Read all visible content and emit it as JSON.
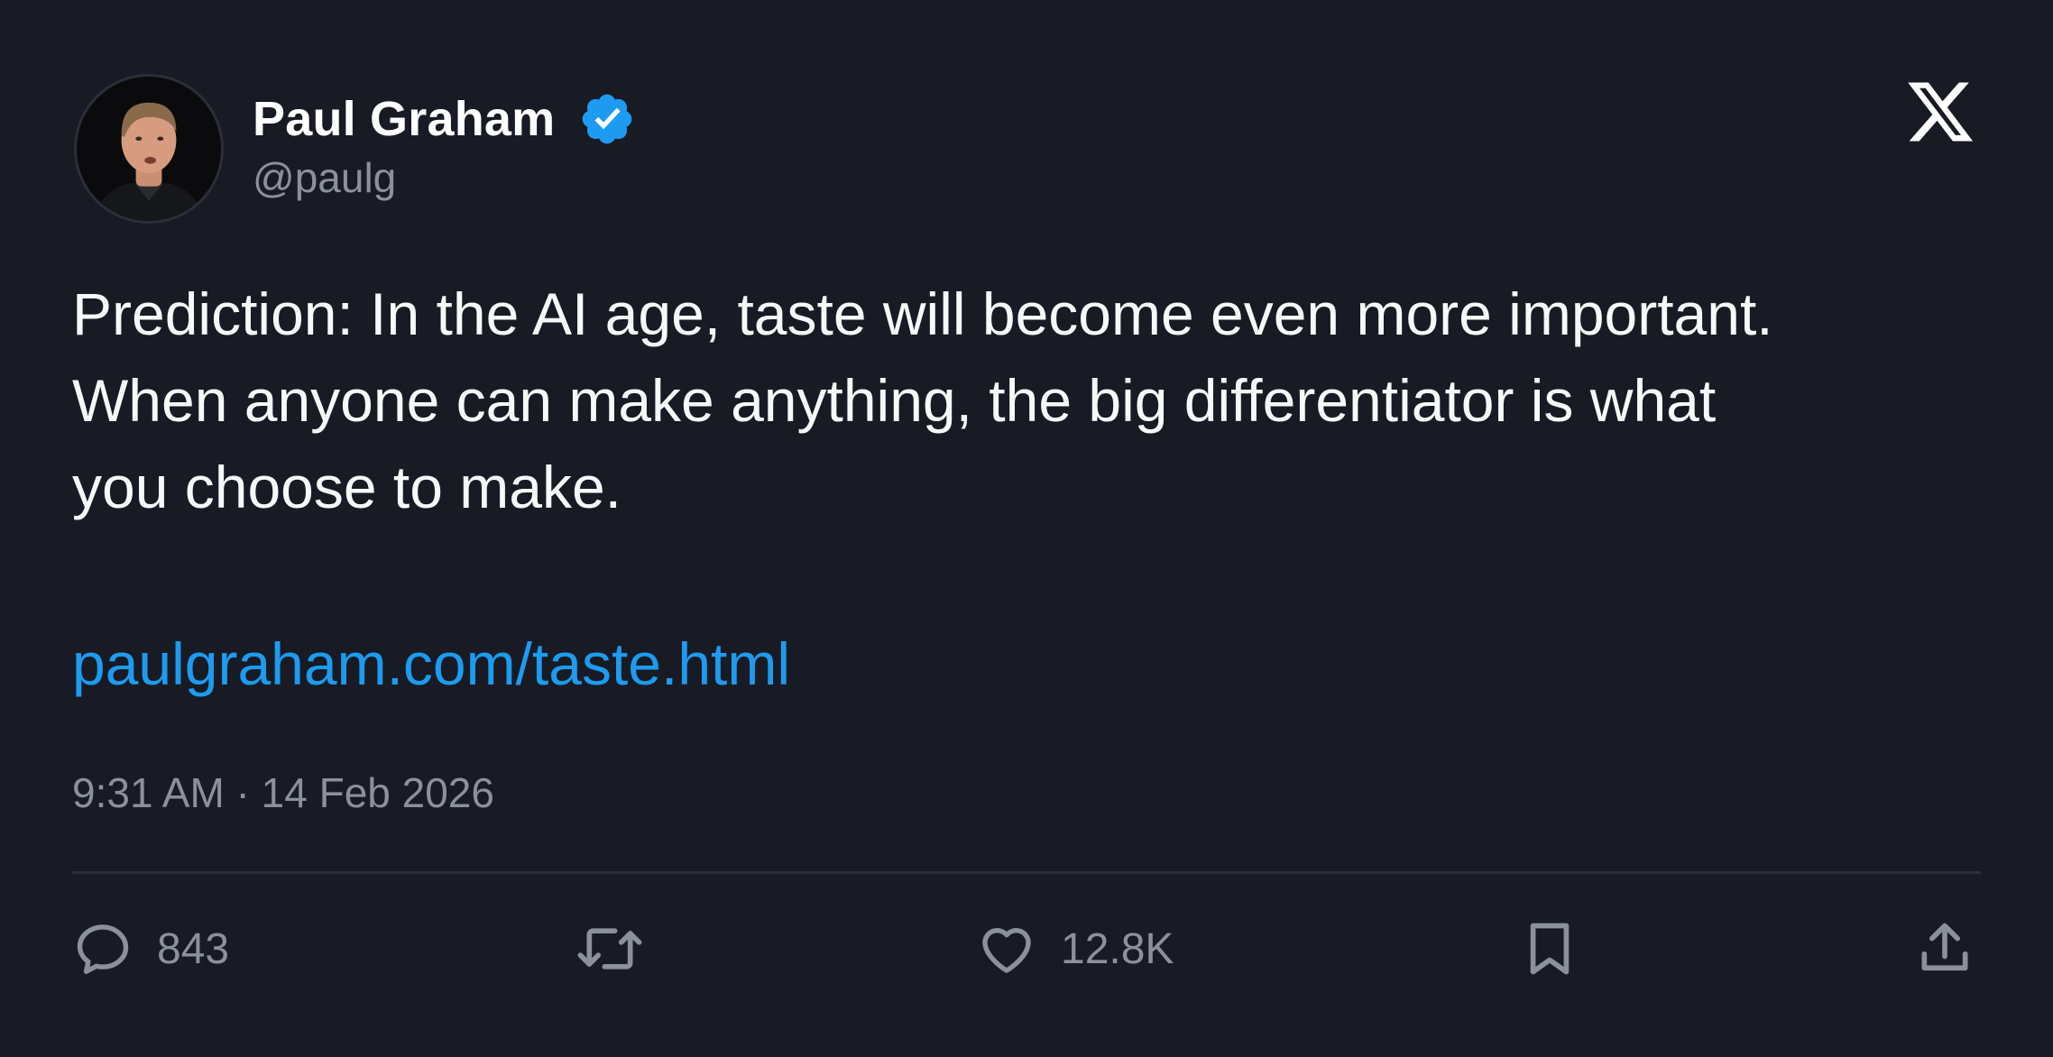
{
  "author": {
    "name": "Paul Graham",
    "handle": "@paulg",
    "verified": true
  },
  "tweet": {
    "lines": [
      "Prediction: In the AI age, taste will become even more important.",
      "When anyone can make anything, the big differentiator is what",
      "you choose to make."
    ],
    "link": "paulgraham.com/taste.html",
    "timestamp": "9:31 AM · 14 Feb 2026"
  },
  "actions": {
    "reply_count": "843",
    "like_count": "12.8K"
  },
  "icons": {
    "verified": "verified-badge-icon",
    "brand": "x-logo-icon",
    "reply": "reply-icon",
    "retweet": "retweet-icon",
    "like": "heart-icon",
    "bookmark": "bookmark-icon",
    "share": "share-icon"
  },
  "colors": {
    "background": "#181b24",
    "text": "#f7f9f9",
    "secondary": "#8b919a",
    "link": "#1d9bf0",
    "verified": "#1d9bf0"
  }
}
